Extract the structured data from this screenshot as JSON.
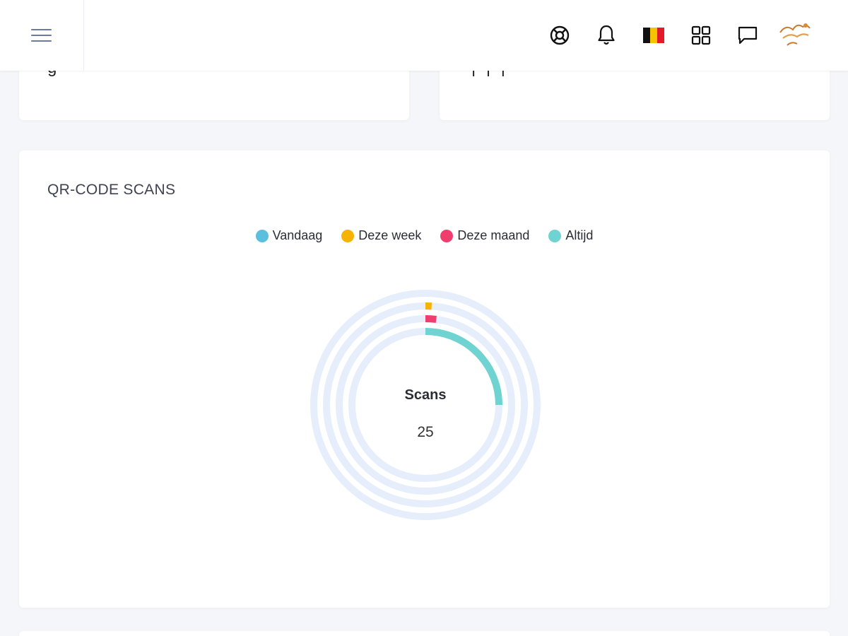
{
  "header": {
    "icons": [
      "lifebuoy-icon",
      "bell-icon",
      "belgium-flag-icon",
      "apps-grid-icon",
      "chat-icon"
    ],
    "avatar": "user-avatar"
  },
  "cards": {
    "left_peek": "g",
    "right_peek": "| | |"
  },
  "qr_scans": {
    "title": "QR-CODE SCANS",
    "center_label": "Scans",
    "center_value": "25"
  },
  "colors": {
    "track": "#e6eefc",
    "vandaag": "#5bc0de",
    "deze_week": "#f6b400",
    "deze_maand": "#f13c6e",
    "altijd": "#6fd3d1"
  },
  "chart_data": {
    "type": "radialBar",
    "series": [
      {
        "name": "Vandaag",
        "value": 0
      },
      {
        "name": "Deze week",
        "value": 1
      },
      {
        "name": "Deze maand",
        "value": 2
      },
      {
        "name": "Altijd",
        "value": 25
      }
    ],
    "max": 100,
    "legend_position": "top-center",
    "center_label": "Scans",
    "center_value": 25
  }
}
